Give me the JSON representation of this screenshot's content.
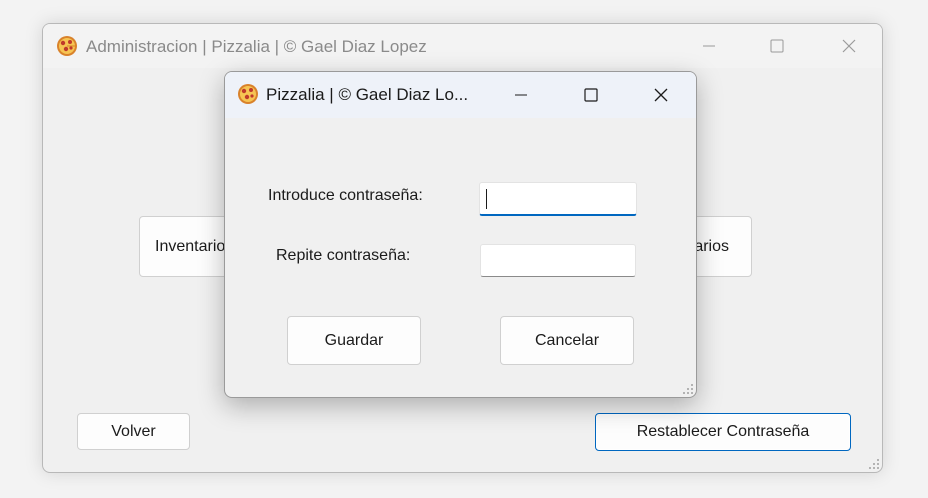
{
  "main_window": {
    "title": "Administracion | Pizzalia |  © Gael Diaz Lopez",
    "icon": "pizza-icon",
    "controls": [
      "minimize-icon",
      "maximize-icon",
      "close-icon"
    ],
    "buttons": {
      "inventario": "Inventario",
      "usuarios": "Usuarios",
      "volver": "Volver",
      "restablecer": "Restablecer Contraseña"
    }
  },
  "dialog": {
    "title": "Pizzalia |  © Gael Diaz Lo...",
    "icon": "pizza-icon",
    "controls": [
      "minimize-icon",
      "maximize-icon",
      "close-icon"
    ],
    "password_label": "Introduce contraseña:",
    "password_value": "",
    "repeat_label": "Repite contraseña:",
    "repeat_value": "",
    "guardar": "Guardar",
    "cancelar": "Cancelar"
  },
  "colors": {
    "focus_accent": "#0067c0",
    "focused_button_border": "#0067c0"
  }
}
